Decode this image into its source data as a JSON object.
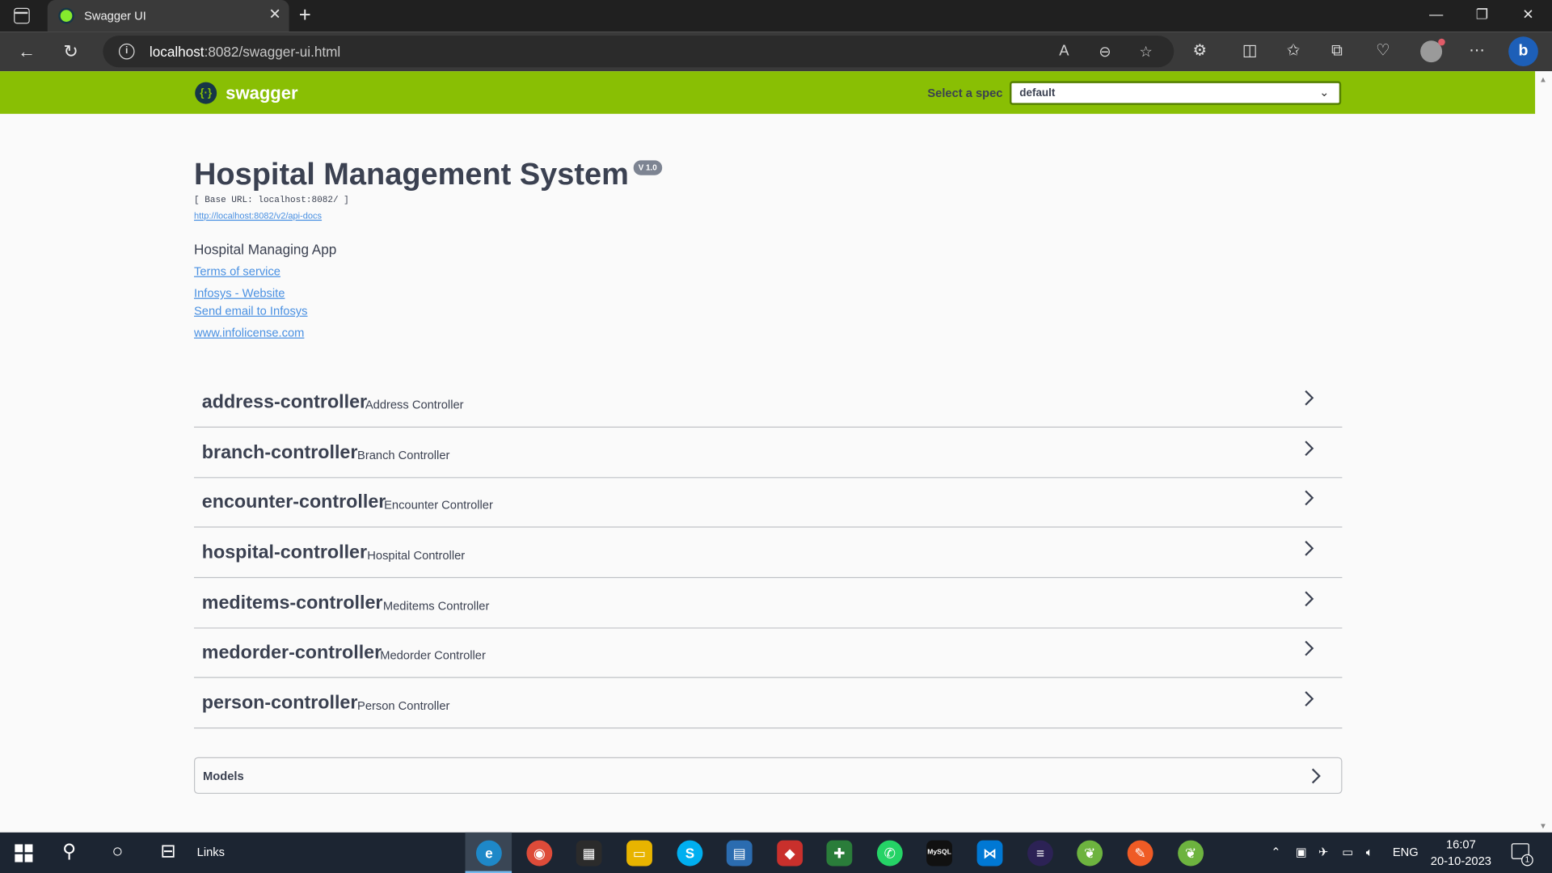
{
  "browser": {
    "tab_title": "Swagger UI",
    "url_host": "localhost",
    "url_rest": ":8082/swagger-ui.html"
  },
  "swagger": {
    "logo_text": "swagger",
    "spec_label": "Select a spec",
    "spec_value": "default",
    "brand_color": "#89bf04"
  },
  "info": {
    "title": "Hospital Management System",
    "version": "V 1.0",
    "base_url": "[ Base URL: localhost:8082/ ]",
    "api_docs_link": "http://localhost:8082/v2/api-docs",
    "description": "Hospital Managing App",
    "terms": "Terms of service",
    "website": "Infosys - Website",
    "email": "Send email to Infosys",
    "license": "www.infolicense.com"
  },
  "controllers": [
    {
      "name": "address-controller",
      "description": "Address Controller"
    },
    {
      "name": "branch-controller",
      "description": "Branch Controller"
    },
    {
      "name": "encounter-controller",
      "description": "Encounter Controller"
    },
    {
      "name": "hospital-controller",
      "description": "Hospital Controller"
    },
    {
      "name": "meditems-controller",
      "description": "Meditems Controller"
    },
    {
      "name": "medorder-controller",
      "description": "Medorder Controller"
    },
    {
      "name": "person-controller",
      "description": "Person Controller"
    }
  ],
  "models_label": "Models",
  "taskbar": {
    "links_label": "Links",
    "language": "ENG",
    "time": "16:07",
    "date": "20-10-2023",
    "notification_count": "1"
  }
}
